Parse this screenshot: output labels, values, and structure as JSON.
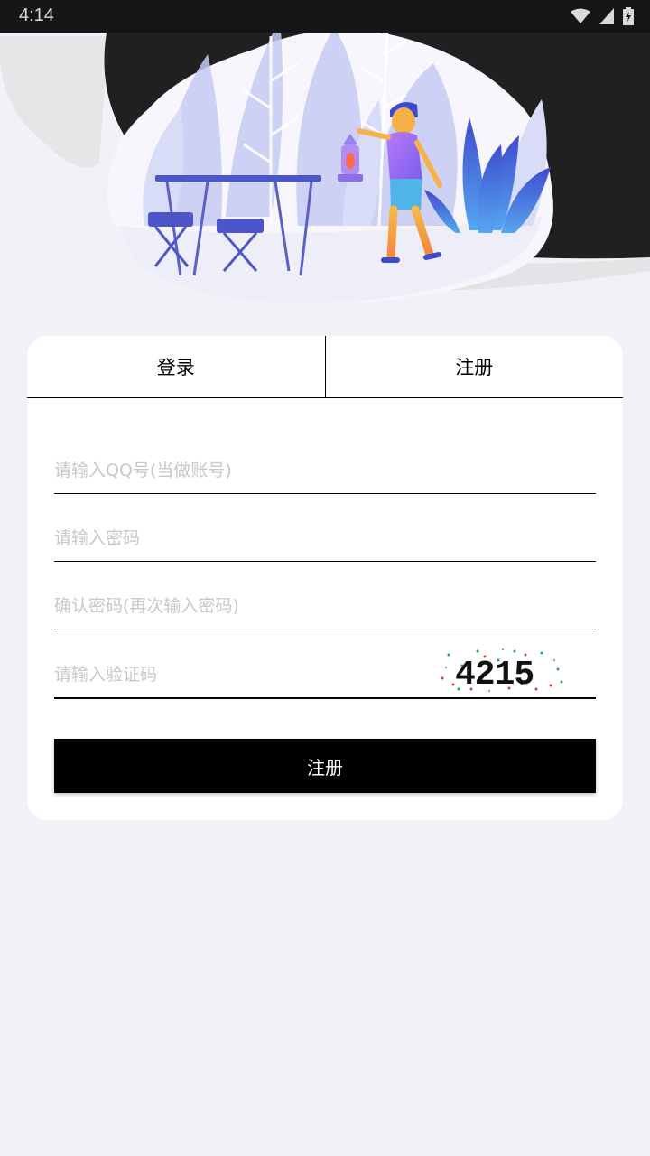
{
  "status_bar": {
    "time": "4:14",
    "icons": [
      "wifi-icon",
      "signal-icon",
      "battery-icon"
    ]
  },
  "hero": {
    "illustration": "camping-scene-illustration"
  },
  "tabs": {
    "login": "登录",
    "register": "注册",
    "active": "register"
  },
  "form": {
    "qq_placeholder": "请输入QQ号(当做账号)",
    "qq_value": "",
    "password_placeholder": "请输入密码",
    "password_value": "",
    "confirm_placeholder": "确认密码(再次输入密码)",
    "confirm_value": "",
    "captcha_placeholder": "请输入验证码",
    "captcha_value": "",
    "captcha_code": "4215",
    "submit_label": "注册"
  },
  "colors": {
    "background": "#f1f2f7",
    "card": "#ffffff",
    "button": "#000000",
    "accent_illustration": "#6a6fd6"
  }
}
